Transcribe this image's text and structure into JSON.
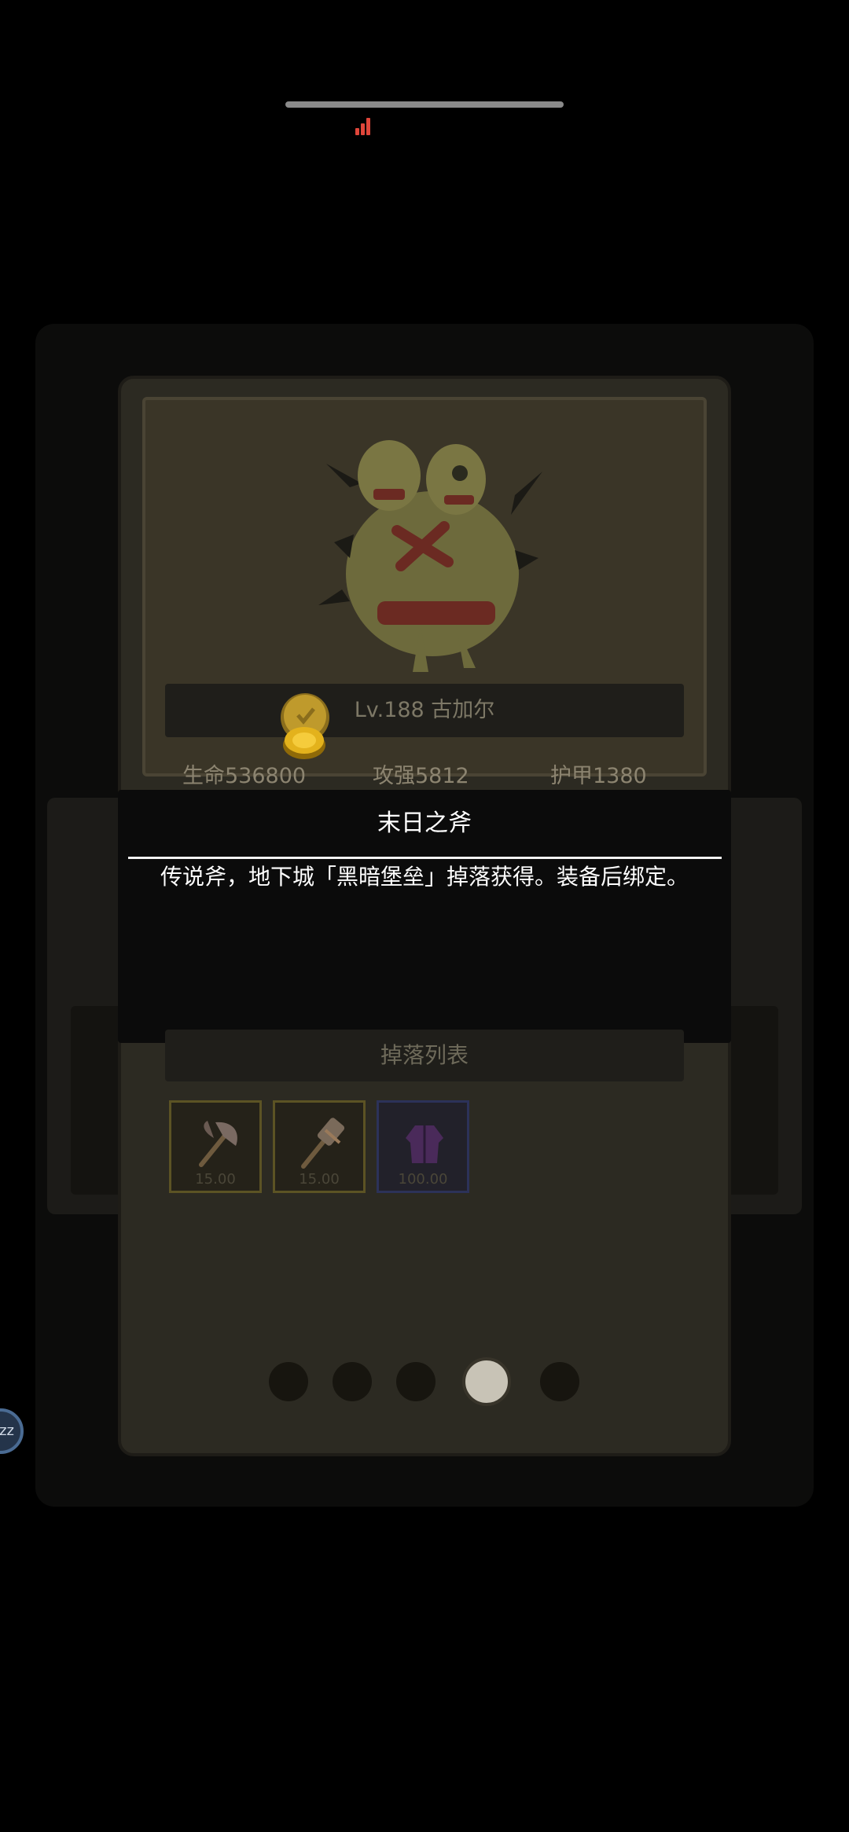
{
  "boss": {
    "name": "Lv.188 古加尔",
    "hp": "生命536800",
    "attack": "攻强5812",
    "armor": "护甲1380"
  },
  "tooltip": {
    "title": "末日之斧",
    "description": "传说斧，地下城「黑暗堡垒」掉落获得。装备后绑定。"
  },
  "drops": {
    "header": "掉落列表",
    "items": [
      {
        "icon": "axe-icon",
        "qty": "15.00"
      },
      {
        "icon": "hammer-icon",
        "qty": "15.00"
      },
      {
        "icon": "robe-icon",
        "qty": "100.00"
      }
    ]
  },
  "pager": {
    "count": 5,
    "active_index": 3
  },
  "float_button": {
    "label": "zz"
  },
  "colors": {
    "background": "#000000",
    "card": "#2c2a22",
    "popup": "#0b0b0b",
    "accent_coin": "#d9a419"
  }
}
